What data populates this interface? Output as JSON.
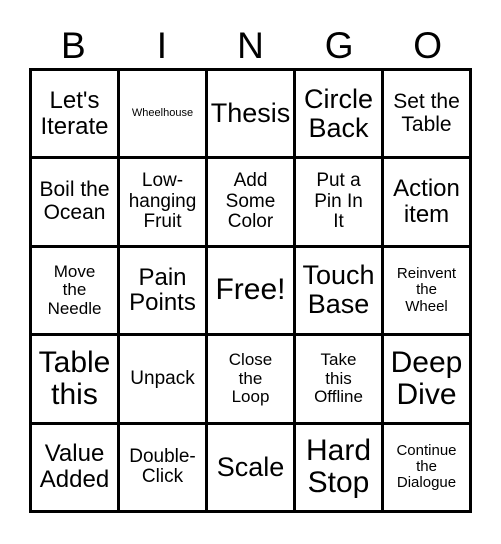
{
  "card": {
    "title": "BINGO",
    "header_letters": [
      "B",
      "I",
      "N",
      "G",
      "O"
    ],
    "border_color": "#000000",
    "background_color": "#ffffff",
    "text_color": "#000000",
    "rows": 5,
    "columns": 5,
    "cells": [
      {
        "text": "Let's\nIterate",
        "size": "sz-xl",
        "free": false
      },
      {
        "text": "Wheelhouse",
        "size": "sz-xs",
        "free": false
      },
      {
        "text": "Thesis",
        "size": "sz-xxl",
        "free": false
      },
      {
        "text": "Circle\nBack",
        "size": "sz-xxl",
        "free": false
      },
      {
        "text": "Set the\nTable",
        "size": "sz-l",
        "free": false
      },
      {
        "text": "Boil the\nOcean",
        "size": "sz-l",
        "free": false
      },
      {
        "text": "Low-\nhanging\nFruit",
        "size": "sz-ml",
        "free": false
      },
      {
        "text": "Add\nSome\nColor",
        "size": "sz-ml",
        "free": false
      },
      {
        "text": "Put a\nPin In\nIt",
        "size": "sz-ml",
        "free": false
      },
      {
        "text": "Action\nitem",
        "size": "sz-xl",
        "free": false
      },
      {
        "text": "Move\nthe\nNeedle",
        "size": "sz-m",
        "free": false
      },
      {
        "text": "Pain\nPoints",
        "size": "sz-xl",
        "free": false
      },
      {
        "text": "Free!",
        "size": "sz-3xl",
        "free": true
      },
      {
        "text": "Touch\nBase",
        "size": "sz-xxl",
        "free": false
      },
      {
        "text": "Reinvent\nthe\nWheel",
        "size": "sz-s",
        "free": false
      },
      {
        "text": "Table\nthis",
        "size": "sz-3xl",
        "free": false
      },
      {
        "text": "Unpack",
        "size": "sz-ml",
        "free": false
      },
      {
        "text": "Close\nthe\nLoop",
        "size": "sz-m",
        "free": false
      },
      {
        "text": "Take\nthis\nOffline",
        "size": "sz-m",
        "free": false
      },
      {
        "text": "Deep\nDive",
        "size": "sz-3xl",
        "free": false
      },
      {
        "text": "Value\nAdded",
        "size": "sz-xl",
        "free": false
      },
      {
        "text": "Double-\nClick",
        "size": "sz-ml",
        "free": false
      },
      {
        "text": "Scale",
        "size": "sz-xxl",
        "free": false
      },
      {
        "text": "Hard\nStop",
        "size": "sz-3xl",
        "free": false
      },
      {
        "text": "Continue\nthe\nDialogue",
        "size": "sz-s",
        "free": false
      }
    ]
  }
}
